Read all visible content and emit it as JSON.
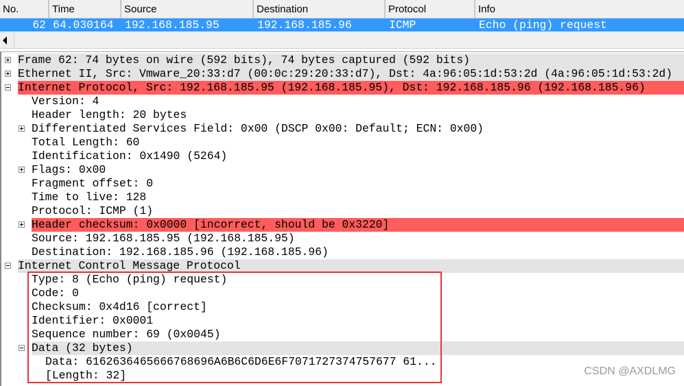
{
  "packet_list": {
    "columns": [
      "No.",
      "Time",
      "Source",
      "Destination",
      "Protocol",
      "Info"
    ],
    "selected_row": {
      "no": "62",
      "time": "64.030164",
      "source": "192.168.185.95",
      "destination": "192.168.185.96",
      "protocol": "ICMP",
      "info": "Echo (ping) request"
    }
  },
  "details": [
    {
      "text": "Frame 62: 74 bytes on wire (592 bits), 74 bytes captured (592 bits)",
      "toggle": "plus",
      "style": "gray",
      "indent": 0
    },
    {
      "text": "Ethernet II, Src: Vmware_20:33:d7 (00:0c:29:20:33:d7), Dst: 4a:96:05:1d:53:2d (4a:96:05:1d:53:2d)",
      "toggle": "plus",
      "style": "gray",
      "indent": 0
    },
    {
      "text": "Internet Protocol, Src: 192.168.185.95 (192.168.185.95), Dst: 192.168.185.96 (192.168.185.96)",
      "toggle": "minus",
      "style": "red",
      "indent": 0
    },
    {
      "text": "Version: 4",
      "indent": 1
    },
    {
      "text": "Header length: 20 bytes",
      "indent": 1
    },
    {
      "text": "Differentiated Services Field: 0x00 (DSCP 0x00: Default; ECN: 0x00)",
      "toggle": "plus",
      "indent": 1
    },
    {
      "text": "Total Length: 60",
      "indent": 1
    },
    {
      "text": "Identification: 0x1490 (5264)",
      "indent": 1
    },
    {
      "text": "Flags: 0x00",
      "toggle": "plus",
      "indent": 1
    },
    {
      "text": "Fragment offset: 0",
      "indent": 1
    },
    {
      "text": "Time to live: 128",
      "indent": 1
    },
    {
      "text": "Protocol: ICMP (1)",
      "indent": 1
    },
    {
      "text": "Header checksum: 0x0000 [incorrect, should be 0x3220]",
      "toggle": "plus",
      "style": "red",
      "indent": 1
    },
    {
      "text": "Source: 192.168.185.95 (192.168.185.95)",
      "indent": 1
    },
    {
      "text": "Destination: 192.168.185.96 (192.168.185.96)",
      "indent": 1
    },
    {
      "text": "Internet Control Message Protocol",
      "toggle": "minus",
      "style": "gray",
      "indent": 0
    },
    {
      "text": "Type: 8 (Echo (ping) request)",
      "indent": 1
    },
    {
      "text": "Code: 0",
      "indent": 1
    },
    {
      "text": "Checksum: 0x4d16 [correct]",
      "indent": 1
    },
    {
      "text": "Identifier: 0x0001",
      "indent": 1
    },
    {
      "text": "Sequence number: 69 (0x0045)",
      "indent": 1
    },
    {
      "text": "Data (32 bytes)",
      "toggle": "minus",
      "style": "gray",
      "indent": 1
    },
    {
      "text": "Data: 6162636465666768696A6B6C6D6E6F7071727374757677 61...",
      "indent": 2
    },
    {
      "text": "[Length: 32]",
      "indent": 2
    }
  ],
  "watermark": "CSDN @AXDLMG",
  "colors": {
    "selection": "#3399ff",
    "error": "#ff5c5c",
    "highlight_box": "#e53333"
  }
}
